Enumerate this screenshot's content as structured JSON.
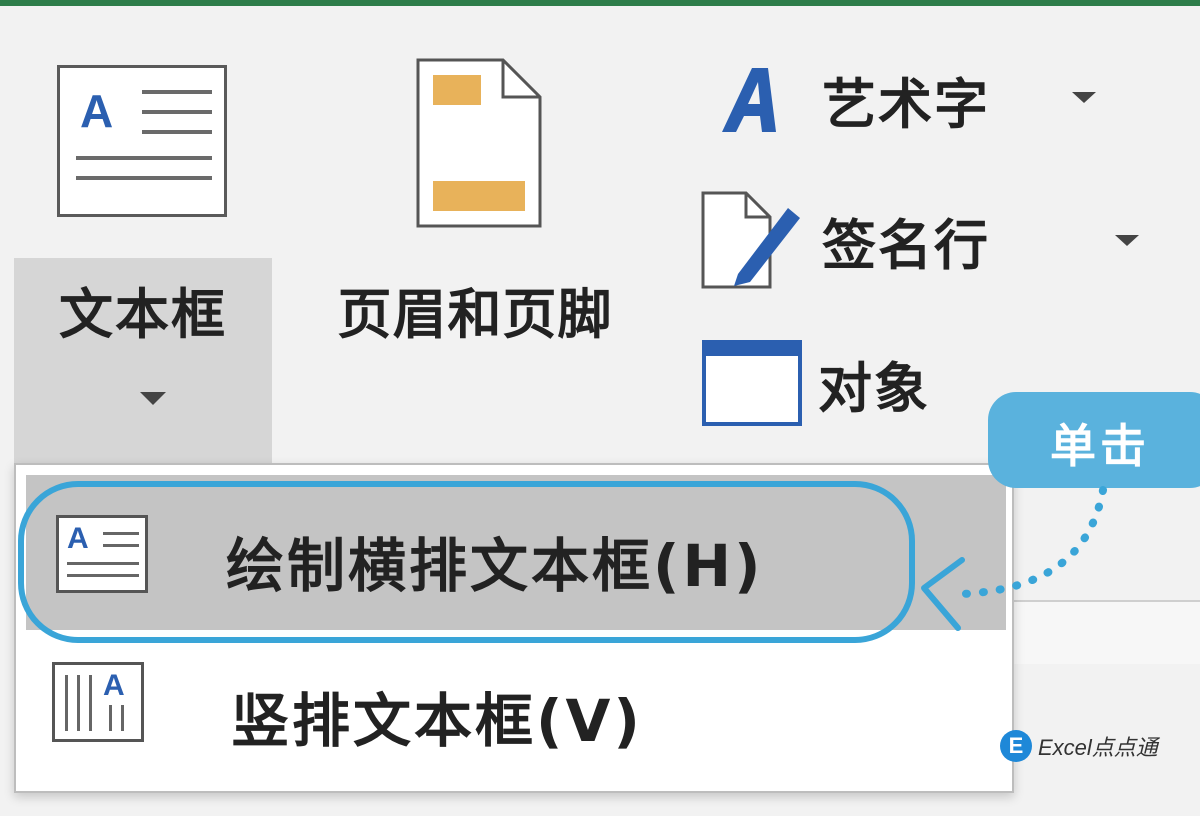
{
  "ribbon": {
    "textbox": {
      "label": "文本框",
      "icon_letter": "A",
      "icon": "textbox-icon",
      "caret": "chevron-down-icon"
    },
    "header_footer": {
      "label": "页眉和页脚",
      "icon": "header-footer-icon"
    },
    "wordart": {
      "label": "艺术字",
      "icon_letter": "A",
      "icon": "wordart-icon"
    },
    "signature_line": {
      "label": "签名行",
      "icon": "signature-line-icon"
    },
    "object": {
      "label": "对象",
      "icon": "object-icon"
    }
  },
  "menu": {
    "items": [
      {
        "label": "绘制横排文本框(H)",
        "icon": "horizontal-textbox-icon",
        "icon_letter": "A",
        "highlighted": true
      },
      {
        "label": "竖排文本框(V)",
        "icon": "vertical-textbox-icon",
        "icon_letter": "A",
        "highlighted": false
      }
    ]
  },
  "annotation": {
    "callout_text": "单击"
  },
  "watermark": {
    "badge": "E",
    "text": "Excel点点通"
  },
  "colors": {
    "accent_blue": "#3aa5d8",
    "icon_blue": "#2b5fb0",
    "header_footer_orange": "#e8b25a",
    "hover_gray": "#c4c4c4",
    "top_border_green": "#2e7d4a"
  }
}
